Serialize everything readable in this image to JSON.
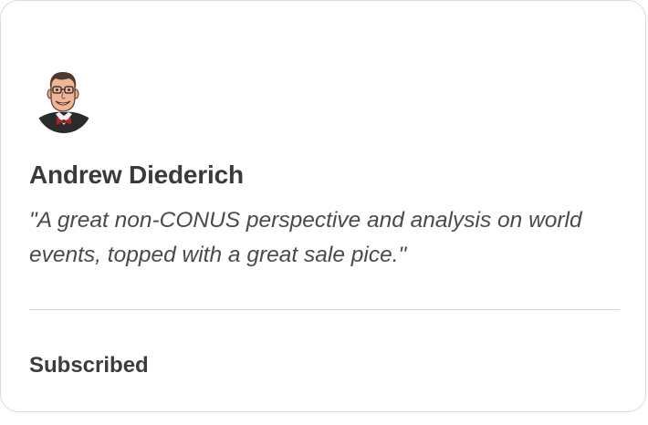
{
  "testimonial": {
    "author_name": "Andrew Diederich",
    "quote": "\"A great non-CONUS perspective and analysis on world events, topped with a great sale pice.\"",
    "status": "Subscribed",
    "avatar_icon": "cartoon-portrait-avatar"
  },
  "colors": {
    "card_border": "#dcdcdc",
    "text_dark": "#3a3a3a",
    "divider": "#d4d4d4"
  }
}
